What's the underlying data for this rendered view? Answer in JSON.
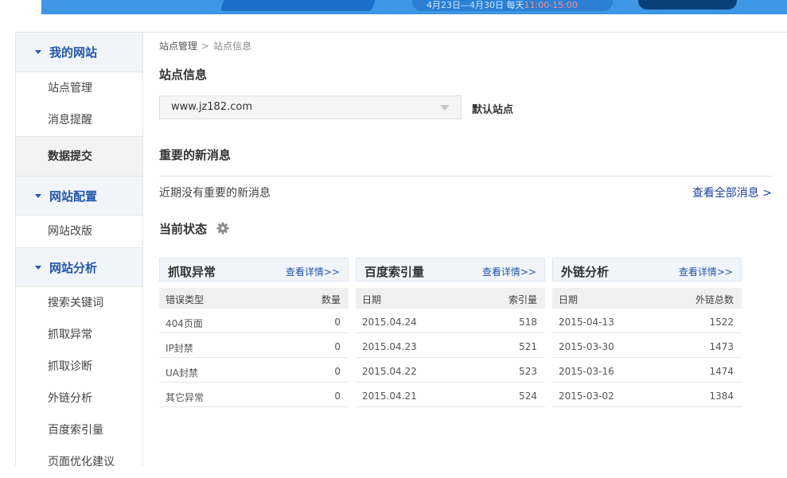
{
  "banner": {
    "promo_text_prefix": "4月23日—4月30日 每天",
    "promo_time": "11:00-15:00"
  },
  "sidebar": {
    "sections": [
      {
        "title": "我的网站",
        "items": [
          {
            "label": "站点管理"
          },
          {
            "label": "消息提醒"
          },
          {
            "label": "数据提交",
            "active": true
          }
        ]
      },
      {
        "title": "网站配置",
        "items": [
          {
            "label": "网站改版"
          }
        ]
      },
      {
        "title": "网站分析",
        "items": [
          {
            "label": "搜索关键词"
          },
          {
            "label": "抓取异常"
          },
          {
            "label": "抓取诊断"
          },
          {
            "label": "外链分析"
          },
          {
            "label": "百度索引量"
          },
          {
            "label": "页面优化建议"
          }
        ]
      }
    ]
  },
  "breadcrumb": {
    "root": "站点管理",
    "separator": ">",
    "current": "站点信息"
  },
  "site_info": {
    "title": "站点信息",
    "selected_site": "www.jz182.com",
    "default_label": "默认站点"
  },
  "news": {
    "title": "重要的新消息",
    "empty_text": "近期没有重要的新消息",
    "view_all": "查看全部消息 >"
  },
  "status": {
    "title": "当前状态",
    "icon": "gear-icon"
  },
  "cards": [
    {
      "title": "抓取异常",
      "link": "查看详情>>",
      "col_left": "错误类型",
      "col_right": "数量",
      "rows": [
        {
          "left": "404页面",
          "right": "0"
        },
        {
          "left": "IP封禁",
          "right": "0"
        },
        {
          "left": "UA封禁",
          "right": "0"
        },
        {
          "left": "其它异常",
          "right": "0"
        }
      ]
    },
    {
      "title": "百度索引量",
      "link": "查看详情>>",
      "col_left": "日期",
      "col_right": "索引量",
      "rows": [
        {
          "left": "2015.04.24",
          "right": "518"
        },
        {
          "left": "2015.04.23",
          "right": "521"
        },
        {
          "left": "2015.04.22",
          "right": "523"
        },
        {
          "left": "2015.04.21",
          "right": "524"
        }
      ]
    },
    {
      "title": "外链分析",
      "link": "查看详情>>",
      "col_left": "日期",
      "col_right": "外链总数",
      "rows": [
        {
          "left": "2015-04-13",
          "right": "1522"
        },
        {
          "left": "2015-03-30",
          "right": "1473"
        },
        {
          "left": "2015-03-16",
          "right": "1474"
        },
        {
          "left": "2015-03-02",
          "right": "1384"
        }
      ]
    }
  ],
  "colors": {
    "accent": "#2356a8",
    "link": "#1a3f9f",
    "header_bg": "#f1f5fa",
    "banner": "#3d96e6"
  }
}
